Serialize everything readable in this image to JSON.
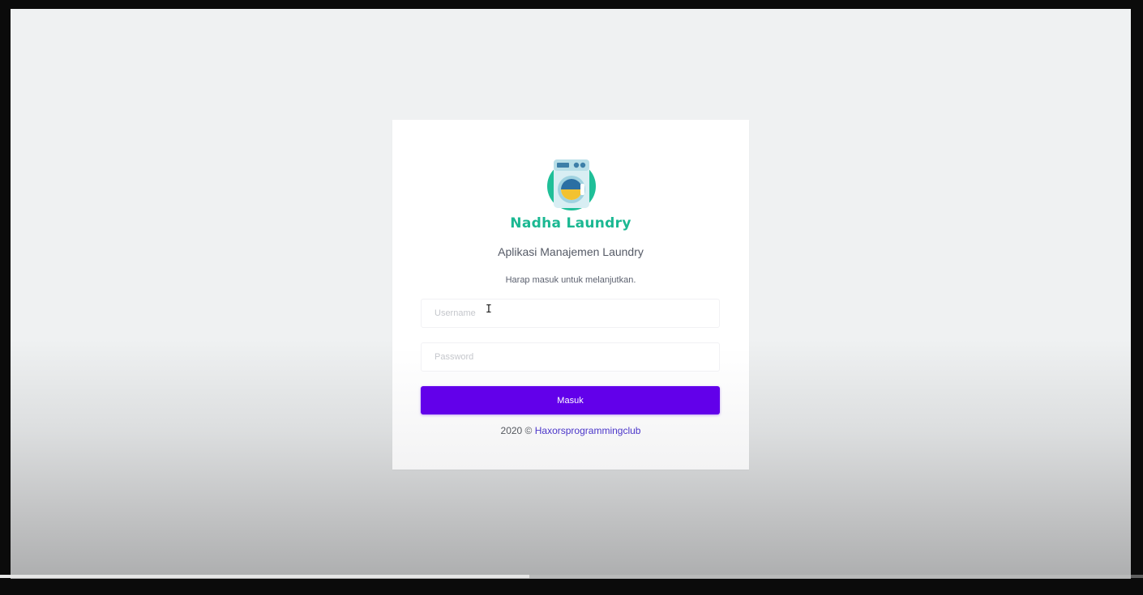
{
  "brand": {
    "name": "Nadha Laundry",
    "color": "#1bb892"
  },
  "logo": {
    "icon": "washing-machine-icon"
  },
  "app_title": "Aplikasi Manajemen Laundry",
  "prompt": "Harap masuk untuk melanjutkan.",
  "form": {
    "username": {
      "placeholder": "Username",
      "value": ""
    },
    "password": {
      "placeholder": "Password",
      "value": ""
    },
    "submit_label": "Masuk",
    "submit_color": "#6200ea"
  },
  "footer": {
    "prefix": "2020 © ",
    "link_text": "Haxorsprogrammingclub",
    "link_color": "#4a35c9"
  },
  "video_progress": {
    "fraction": 0.463
  }
}
